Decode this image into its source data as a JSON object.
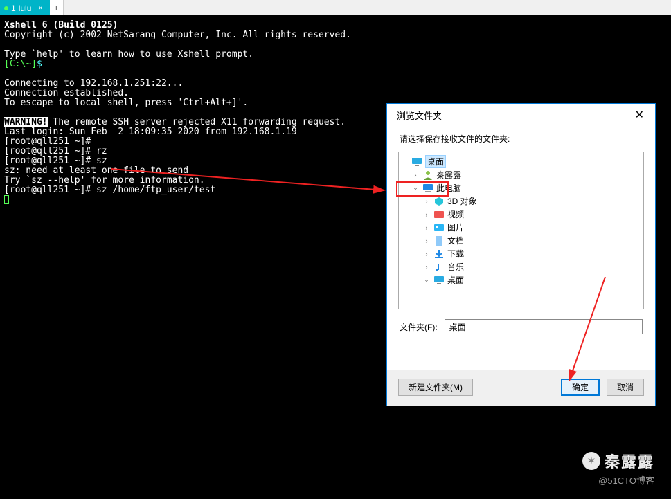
{
  "tab": {
    "index": "1",
    "label": "lulu",
    "close": "×"
  },
  "terminal": {
    "l1": "Xshell 6 (Build 0125)",
    "l2": "Copyright (c) 2002 NetSarang Computer, Inc. All rights reserved.",
    "l3": "Type `help' to learn how to use Xshell prompt.",
    "prompt_local_open": "[C:\\~]",
    "dollar": "$",
    "l5": "Connecting to 192.168.1.251:22...",
    "l6": "Connection established.",
    "l7": "To escape to local shell, press 'Ctrl+Alt+]'.",
    "warn": "WARNING!",
    "warn_rest": " The remote SSH server rejected X11 forwarding request.",
    "l9": "Last login: Sun Feb  2 18:09:35 2020 from 192.168.1.19",
    "ps1": "[root@qll251 ~]#",
    "cmd_rz": " rz",
    "cmd_sz": " sz",
    "l_sz1": "sz: need at least one file to send",
    "l_sz2": "Try `sz --help' for more information.",
    "cmd_sz_full": " sz /home/ftp_user/test"
  },
  "dialog": {
    "title": "浏览文件夹",
    "prompt": "请选择保存接收文件的文件夹:",
    "tree": {
      "desktop": "桌面",
      "user": "秦露露",
      "thispc": "此电脑",
      "obj3d": "3D 对象",
      "videos": "视频",
      "pictures": "图片",
      "documents": "文档",
      "downloads": "下载",
      "music": "音乐",
      "desktop2": "桌面"
    },
    "folder_label": "文件夹(F):",
    "folder_value": "桌面",
    "new_folder": "新建文件夹(M)",
    "ok": "确定",
    "cancel": "取消"
  },
  "watermark": {
    "name": "秦露露",
    "sub": "@51CTO博客"
  }
}
